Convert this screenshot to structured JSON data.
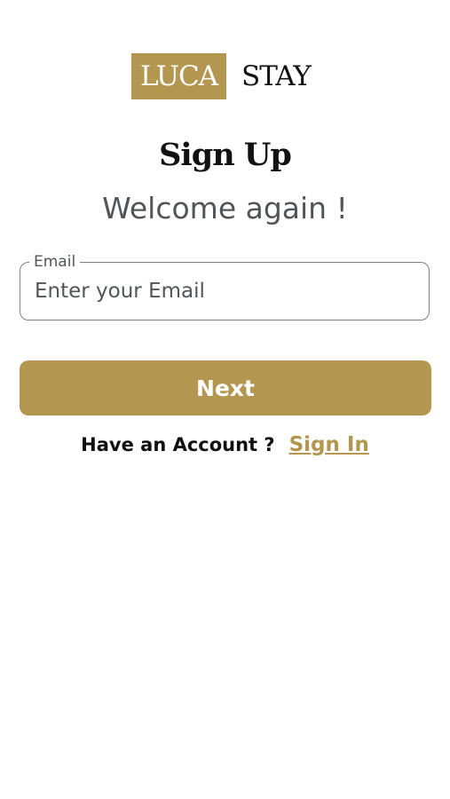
{
  "brand": {
    "box_text": "LUCA",
    "text": "STAY",
    "accent_color": "#b39650"
  },
  "header": {
    "title": "Sign Up",
    "subtitle": "Welcome again !"
  },
  "form": {
    "email_label": "Email",
    "email_placeholder": "Enter your Email",
    "email_value": "",
    "next_label": "Next"
  },
  "footer": {
    "account_prompt": "Have an Account ?",
    "signin_label": "Sign In"
  }
}
